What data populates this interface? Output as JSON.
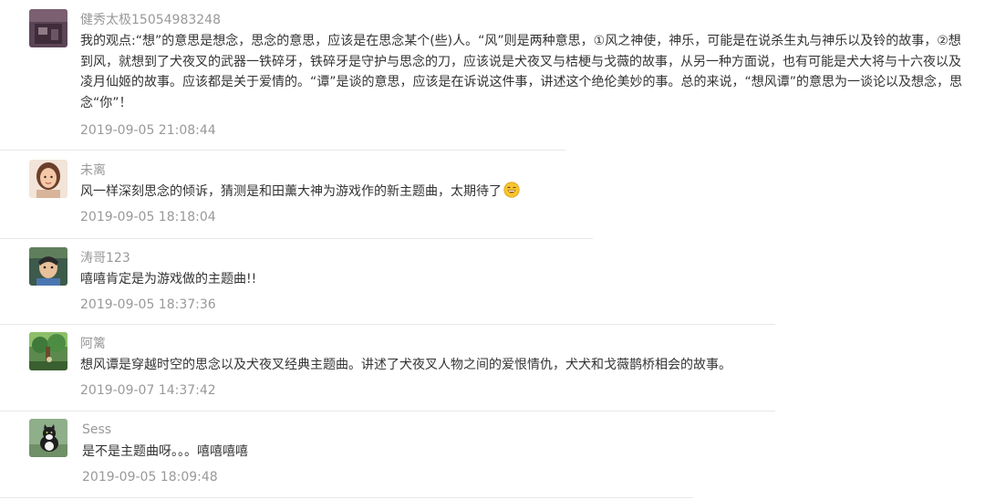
{
  "comments": [
    {
      "username": "健秀太极15054983248",
      "avatar": "avatar-dark-purple",
      "content": "我的观点:“想”的意思是想念，思念的意思，应该是在思念某个(些)人。“风”则是两种意思，①风之神使，神乐，可能是在说杀生丸与神乐以及铃的故事，②想到风，就想到了犬夜叉的武器一铁碎牙，铁碎牙是守护与思念的刀，应该说是犬夜叉与桔梗与戈薇的故事，从另一种方面说，也有可能是犬大将与十六夜以及凌月仙姬的故事。应该都是关于爱情的。“谭”是谈的意思，应该是在诉说这件事，讲述这个绝伦美妙的事。总的来说，“想风谭”的意思为一谈论以及想念，思念“你”！",
      "time": "2019-09-05 21:08:44"
    },
    {
      "username": "未离",
      "avatar": "avatar-girl-portrait",
      "content": "风一样深刻思念的倾诉，猜测是和田薰大神为游戏作的新主题曲，太期待了",
      "emoji": "laughing-face-emoji",
      "time": "2019-09-05 18:18:04"
    },
    {
      "username": "涛哥123",
      "avatar": "avatar-anime-character",
      "content": "嘻嘻肯定是为游戏做的主题曲!!",
      "time": "2019-09-05 18:37:36"
    },
    {
      "username": "阿篱",
      "avatar": "avatar-forest-scene",
      "content": "想风谭是穿越时空的思念以及犬夜叉经典主题曲。讲述了犬夜叉人物之间的爱恨情仇，犬犬和戈薇鹊桥相会的故事。",
      "time": "2019-09-07 14:37:42"
    },
    {
      "username": "Sess",
      "avatar": "avatar-black-white-cat",
      "content": "是不是主题曲呀。。。嘻嘻嘻嘻",
      "time": "2019-09-05 18:09:48"
    }
  ]
}
